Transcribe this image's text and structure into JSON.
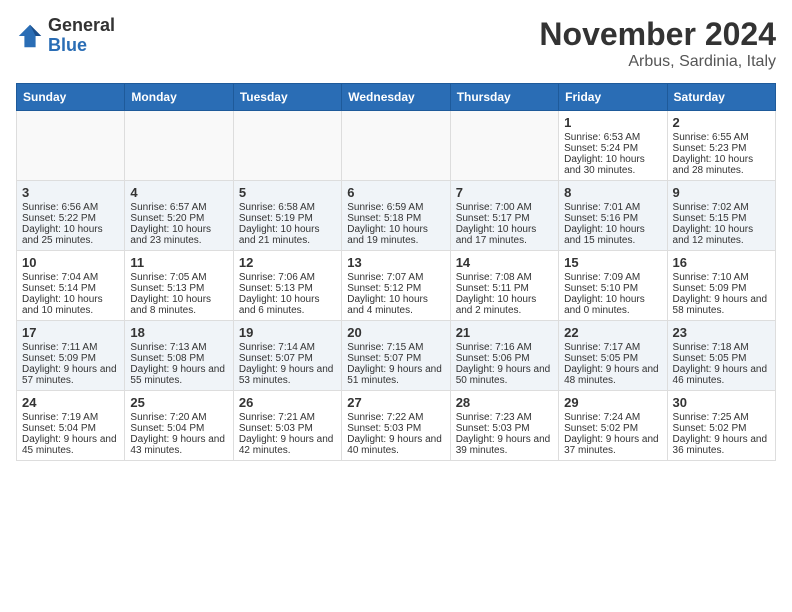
{
  "header": {
    "logo": {
      "general": "General",
      "blue": "Blue"
    },
    "title": "November 2024",
    "location": "Arbus, Sardinia, Italy"
  },
  "calendar": {
    "days_of_week": [
      "Sunday",
      "Monday",
      "Tuesday",
      "Wednesday",
      "Thursday",
      "Friday",
      "Saturday"
    ],
    "weeks": [
      [
        {
          "day": "",
          "empty": true
        },
        {
          "day": "",
          "empty": true
        },
        {
          "day": "",
          "empty": true
        },
        {
          "day": "",
          "empty": true
        },
        {
          "day": "",
          "empty": true
        },
        {
          "day": "1",
          "sunrise": "Sunrise: 6:53 AM",
          "sunset": "Sunset: 5:24 PM",
          "daylight": "Daylight: 10 hours and 30 minutes."
        },
        {
          "day": "2",
          "sunrise": "Sunrise: 6:55 AM",
          "sunset": "Sunset: 5:23 PM",
          "daylight": "Daylight: 10 hours and 28 minutes."
        }
      ],
      [
        {
          "day": "3",
          "sunrise": "Sunrise: 6:56 AM",
          "sunset": "Sunset: 5:22 PM",
          "daylight": "Daylight: 10 hours and 25 minutes."
        },
        {
          "day": "4",
          "sunrise": "Sunrise: 6:57 AM",
          "sunset": "Sunset: 5:20 PM",
          "daylight": "Daylight: 10 hours and 23 minutes."
        },
        {
          "day": "5",
          "sunrise": "Sunrise: 6:58 AM",
          "sunset": "Sunset: 5:19 PM",
          "daylight": "Daylight: 10 hours and 21 minutes."
        },
        {
          "day": "6",
          "sunrise": "Sunrise: 6:59 AM",
          "sunset": "Sunset: 5:18 PM",
          "daylight": "Daylight: 10 hours and 19 minutes."
        },
        {
          "day": "7",
          "sunrise": "Sunrise: 7:00 AM",
          "sunset": "Sunset: 5:17 PM",
          "daylight": "Daylight: 10 hours and 17 minutes."
        },
        {
          "day": "8",
          "sunrise": "Sunrise: 7:01 AM",
          "sunset": "Sunset: 5:16 PM",
          "daylight": "Daylight: 10 hours and 15 minutes."
        },
        {
          "day": "9",
          "sunrise": "Sunrise: 7:02 AM",
          "sunset": "Sunset: 5:15 PM",
          "daylight": "Daylight: 10 hours and 12 minutes."
        }
      ],
      [
        {
          "day": "10",
          "sunrise": "Sunrise: 7:04 AM",
          "sunset": "Sunset: 5:14 PM",
          "daylight": "Daylight: 10 hours and 10 minutes."
        },
        {
          "day": "11",
          "sunrise": "Sunrise: 7:05 AM",
          "sunset": "Sunset: 5:13 PM",
          "daylight": "Daylight: 10 hours and 8 minutes."
        },
        {
          "day": "12",
          "sunrise": "Sunrise: 7:06 AM",
          "sunset": "Sunset: 5:13 PM",
          "daylight": "Daylight: 10 hours and 6 minutes."
        },
        {
          "day": "13",
          "sunrise": "Sunrise: 7:07 AM",
          "sunset": "Sunset: 5:12 PM",
          "daylight": "Daylight: 10 hours and 4 minutes."
        },
        {
          "day": "14",
          "sunrise": "Sunrise: 7:08 AM",
          "sunset": "Sunset: 5:11 PM",
          "daylight": "Daylight: 10 hours and 2 minutes."
        },
        {
          "day": "15",
          "sunrise": "Sunrise: 7:09 AM",
          "sunset": "Sunset: 5:10 PM",
          "daylight": "Daylight: 10 hours and 0 minutes."
        },
        {
          "day": "16",
          "sunrise": "Sunrise: 7:10 AM",
          "sunset": "Sunset: 5:09 PM",
          "daylight": "Daylight: 9 hours and 58 minutes."
        }
      ],
      [
        {
          "day": "17",
          "sunrise": "Sunrise: 7:11 AM",
          "sunset": "Sunset: 5:09 PM",
          "daylight": "Daylight: 9 hours and 57 minutes."
        },
        {
          "day": "18",
          "sunrise": "Sunrise: 7:13 AM",
          "sunset": "Sunset: 5:08 PM",
          "daylight": "Daylight: 9 hours and 55 minutes."
        },
        {
          "day": "19",
          "sunrise": "Sunrise: 7:14 AM",
          "sunset": "Sunset: 5:07 PM",
          "daylight": "Daylight: 9 hours and 53 minutes."
        },
        {
          "day": "20",
          "sunrise": "Sunrise: 7:15 AM",
          "sunset": "Sunset: 5:07 PM",
          "daylight": "Daylight: 9 hours and 51 minutes."
        },
        {
          "day": "21",
          "sunrise": "Sunrise: 7:16 AM",
          "sunset": "Sunset: 5:06 PM",
          "daylight": "Daylight: 9 hours and 50 minutes."
        },
        {
          "day": "22",
          "sunrise": "Sunrise: 7:17 AM",
          "sunset": "Sunset: 5:05 PM",
          "daylight": "Daylight: 9 hours and 48 minutes."
        },
        {
          "day": "23",
          "sunrise": "Sunrise: 7:18 AM",
          "sunset": "Sunset: 5:05 PM",
          "daylight": "Daylight: 9 hours and 46 minutes."
        }
      ],
      [
        {
          "day": "24",
          "sunrise": "Sunrise: 7:19 AM",
          "sunset": "Sunset: 5:04 PM",
          "daylight": "Daylight: 9 hours and 45 minutes."
        },
        {
          "day": "25",
          "sunrise": "Sunrise: 7:20 AM",
          "sunset": "Sunset: 5:04 PM",
          "daylight": "Daylight: 9 hours and 43 minutes."
        },
        {
          "day": "26",
          "sunrise": "Sunrise: 7:21 AM",
          "sunset": "Sunset: 5:03 PM",
          "daylight": "Daylight: 9 hours and 42 minutes."
        },
        {
          "day": "27",
          "sunrise": "Sunrise: 7:22 AM",
          "sunset": "Sunset: 5:03 PM",
          "daylight": "Daylight: 9 hours and 40 minutes."
        },
        {
          "day": "28",
          "sunrise": "Sunrise: 7:23 AM",
          "sunset": "Sunset: 5:03 PM",
          "daylight": "Daylight: 9 hours and 39 minutes."
        },
        {
          "day": "29",
          "sunrise": "Sunrise: 7:24 AM",
          "sunset": "Sunset: 5:02 PM",
          "daylight": "Daylight: 9 hours and 37 minutes."
        },
        {
          "day": "30",
          "sunrise": "Sunrise: 7:25 AM",
          "sunset": "Sunset: 5:02 PM",
          "daylight": "Daylight: 9 hours and 36 minutes."
        }
      ]
    ]
  }
}
